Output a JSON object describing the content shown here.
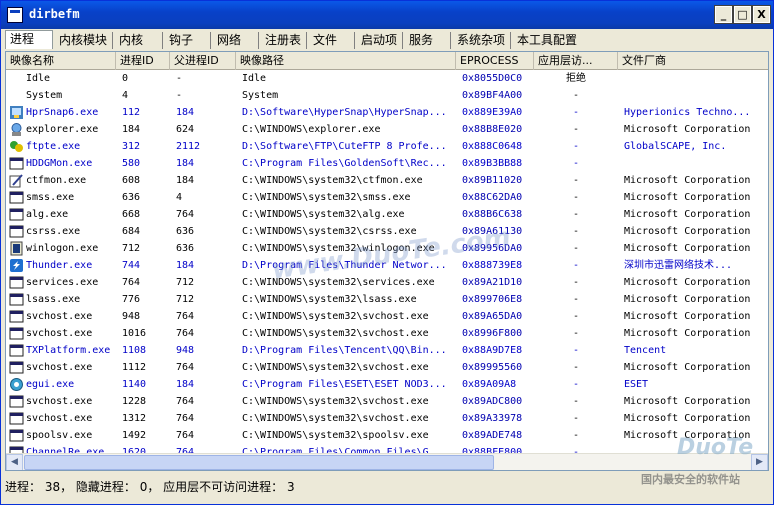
{
  "window": {
    "title": "dirbefm",
    "min_label": "_",
    "max_label": "□",
    "close_label": "X"
  },
  "tabs": [
    "进程",
    "内核模块",
    "内核",
    "钩子",
    "网络",
    "注册表",
    "文件",
    "启动项",
    "服务",
    "系统杂项",
    "本工具配置"
  ],
  "columns": [
    "映像名称",
    "进程ID",
    "父进程ID",
    "映像路径",
    "EPROCESS",
    "应用层访...",
    "文件厂商"
  ],
  "rows": [
    {
      "name": "Idle",
      "pid": "0",
      "ppid": "-",
      "path": "Idle",
      "eprocess": "0x8055D0C0",
      "access": "拒绝",
      "vendor": "",
      "blue": false,
      "icon": "none-icon"
    },
    {
      "name": "System",
      "pid": "4",
      "ppid": "-",
      "path": "System",
      "eprocess": "0x89BF4A00",
      "access": "-",
      "vendor": "",
      "blue": false,
      "icon": "none-icon"
    },
    {
      "name": "HprSnap6.exe",
      "pid": "112",
      "ppid": "184",
      "path": "D:\\Software\\HyperSnap\\HyperSnap...",
      "eprocess": "0x889E39A0",
      "access": "-",
      "vendor": "Hyperionics Techno...",
      "blue": true,
      "icon": "hypersnap-icon"
    },
    {
      "name": "explorer.exe",
      "pid": "184",
      "ppid": "624",
      "path": "C:\\WINDOWS\\explorer.exe",
      "eprocess": "0x88B8E020",
      "access": "-",
      "vendor": "Microsoft Corporation",
      "blue": false,
      "icon": "explorer-icon"
    },
    {
      "name": "ftpte.exe",
      "pid": "312",
      "ppid": "2112",
      "path": "D:\\Software\\FTP\\CuteFTP 8 Profe...",
      "eprocess": "0x888C0648",
      "access": "-",
      "vendor": "GlobalSCAPE, Inc.",
      "blue": true,
      "icon": "cuteftp-icon"
    },
    {
      "name": "HDDGMon.exe",
      "pid": "580",
      "ppid": "184",
      "path": "C:\\Program Files\\GoldenSoft\\Rec...",
      "eprocess": "0x89B3BB88",
      "access": "-",
      "vendor": "",
      "blue": true,
      "icon": "window-icon"
    },
    {
      "name": "ctfmon.exe",
      "pid": "608",
      "ppid": "184",
      "path": "C:\\WINDOWS\\system32\\ctfmon.exe",
      "eprocess": "0x89B11020",
      "access": "-",
      "vendor": "Microsoft Corporation",
      "blue": false,
      "icon": "ctfmon-icon"
    },
    {
      "name": "smss.exe",
      "pid": "636",
      "ppid": "4",
      "path": "C:\\WINDOWS\\system32\\smss.exe",
      "eprocess": "0x88C62DA0",
      "access": "-",
      "vendor": "Microsoft Corporation",
      "blue": false,
      "icon": "window-icon"
    },
    {
      "name": "alg.exe",
      "pid": "668",
      "ppid": "764",
      "path": "C:\\WINDOWS\\system32\\alg.exe",
      "eprocess": "0x88B6C638",
      "access": "-",
      "vendor": "Microsoft Corporation",
      "blue": false,
      "icon": "window-icon"
    },
    {
      "name": "csrss.exe",
      "pid": "684",
      "ppid": "636",
      "path": "C:\\WINDOWS\\system32\\csrss.exe",
      "eprocess": "0x89A61130",
      "access": "-",
      "vendor": "Microsoft Corporation",
      "blue": false,
      "icon": "window-icon"
    },
    {
      "name": "winlogon.exe",
      "pid": "712",
      "ppid": "636",
      "path": "C:\\WINDOWS\\system32\\winlogon.exe",
      "eprocess": "0x89956DA0",
      "access": "-",
      "vendor": "Microsoft Corporation",
      "blue": false,
      "icon": "winlogon-icon"
    },
    {
      "name": "Thunder.exe",
      "pid": "744",
      "ppid": "184",
      "path": "D:\\Program Files\\Thunder Networ...",
      "eprocess": "0x888739E8",
      "access": "-",
      "vendor": "深圳市迅雷网络技术...",
      "blue": true,
      "icon": "thunder-icon"
    },
    {
      "name": "services.exe",
      "pid": "764",
      "ppid": "712",
      "path": "C:\\WINDOWS\\system32\\services.exe",
      "eprocess": "0x89A21D10",
      "access": "-",
      "vendor": "Microsoft Corporation",
      "blue": false,
      "icon": "window-icon"
    },
    {
      "name": "lsass.exe",
      "pid": "776",
      "ppid": "712",
      "path": "C:\\WINDOWS\\system32\\lsass.exe",
      "eprocess": "0x899706E8",
      "access": "-",
      "vendor": "Microsoft Corporation",
      "blue": false,
      "icon": "window-icon"
    },
    {
      "name": "svchost.exe",
      "pid": "948",
      "ppid": "764",
      "path": "C:\\WINDOWS\\system32\\svchost.exe",
      "eprocess": "0x89A65DA0",
      "access": "-",
      "vendor": "Microsoft Corporation",
      "blue": false,
      "icon": "window-icon"
    },
    {
      "name": "svchost.exe",
      "pid": "1016",
      "ppid": "764",
      "path": "C:\\WINDOWS\\system32\\svchost.exe",
      "eprocess": "0x8996F800",
      "access": "-",
      "vendor": "Microsoft Corporation",
      "blue": false,
      "icon": "window-icon"
    },
    {
      "name": "TXPlatform.exe",
      "pid": "1108",
      "ppid": "948",
      "path": "D:\\Program Files\\Tencent\\QQ\\Bin...",
      "eprocess": "0x88A9D7E8",
      "access": "-",
      "vendor": "Tencent",
      "blue": true,
      "icon": "window-icon"
    },
    {
      "name": "svchost.exe",
      "pid": "1112",
      "ppid": "764",
      "path": "C:\\WINDOWS\\system32\\svchost.exe",
      "eprocess": "0x89995560",
      "access": "-",
      "vendor": "Microsoft Corporation",
      "blue": false,
      "icon": "window-icon"
    },
    {
      "name": "egui.exe",
      "pid": "1140",
      "ppid": "184",
      "path": "C:\\Program Files\\ESET\\ESET NOD3...",
      "eprocess": "0x89A09A8",
      "access": "-",
      "vendor": "ESET",
      "blue": true,
      "icon": "eset-icon"
    },
    {
      "name": "svchost.exe",
      "pid": "1228",
      "ppid": "764",
      "path": "C:\\WINDOWS\\system32\\svchost.exe",
      "eprocess": "0x89ADC800",
      "access": "-",
      "vendor": "Microsoft Corporation",
      "blue": false,
      "icon": "window-icon"
    },
    {
      "name": "svchost.exe",
      "pid": "1312",
      "ppid": "764",
      "path": "C:\\WINDOWS\\system32\\svchost.exe",
      "eprocess": "0x89A33978",
      "access": "-",
      "vendor": "Microsoft Corporation",
      "blue": false,
      "icon": "window-icon"
    },
    {
      "name": "spoolsv.exe",
      "pid": "1492",
      "ppid": "764",
      "path": "C:\\WINDOWS\\system32\\spoolsv.exe",
      "eprocess": "0x89ADE748",
      "access": "-",
      "vendor": "Microsoft Corporation",
      "blue": false,
      "icon": "window-icon"
    },
    {
      "name": "ChannelRe.exe",
      "pid": "1620",
      "ppid": "764",
      "path": "C:\\Program Files\\Common Files\\G...",
      "eprocess": "0x88BFE800",
      "access": "-",
      "vendor": "",
      "blue": true,
      "icon": "window-icon"
    }
  ],
  "scrollbar": {
    "left_arrow": "◀",
    "right_arrow": "▶"
  },
  "status": {
    "text": "进程： 38， 隐藏进程： 0， 应用层不可访问进程： 3"
  },
  "watermarks": {
    "center": "www.DuoTe.com",
    "corner_logo": "DuoTe",
    "corner_text": "国内最安全的软件站"
  },
  "colors": {
    "title_blue": "#0a3fbf",
    "row_blue_text": "#0000c8",
    "hex_blue": "#0000b0"
  }
}
